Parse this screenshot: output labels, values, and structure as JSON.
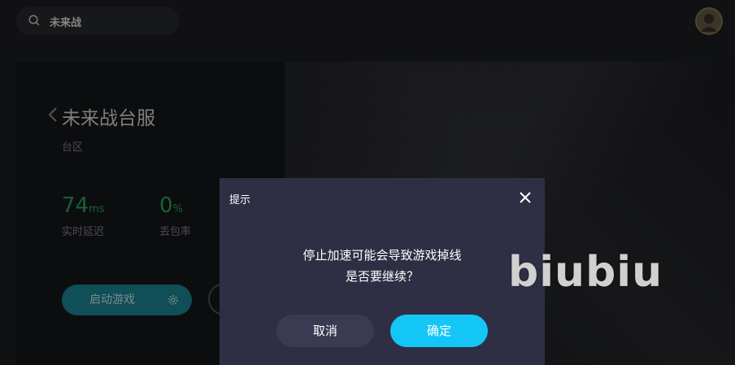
{
  "search": {
    "value": "未来战",
    "icon": "search-icon"
  },
  "header": {
    "avatar_icon": "user-avatar-icon"
  },
  "game": {
    "title": "未来战台服",
    "region": "台区",
    "stats": [
      {
        "value": "74",
        "unit": "ms",
        "label": "实时延迟"
      },
      {
        "value": "0",
        "unit": "%",
        "label": "丢包率"
      }
    ],
    "launch_label": "启动游戏"
  },
  "dialog": {
    "title": "提示",
    "message_line1": "停止加速可能会导致游戏掉线",
    "message_line2": "是否要继续？",
    "cancel_label": "取消",
    "confirm_label": "确定"
  },
  "watermark": "biubiu",
  "colors": {
    "accent": "#14c6f5",
    "stat_green": "#2fae64",
    "dialog_bg": "#2e2e45"
  }
}
